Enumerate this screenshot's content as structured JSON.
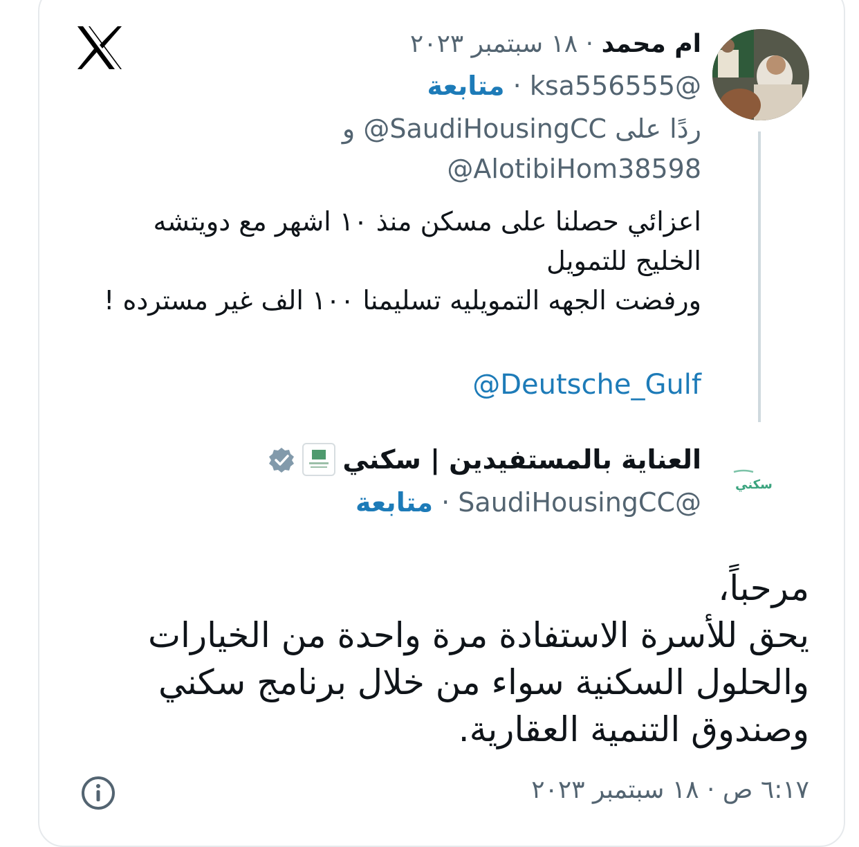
{
  "tweet1": {
    "display_name": "ام محمد",
    "date": "١٨ سبتمبر ٢٠٢٣",
    "handle": "@ksa556555",
    "follow_label": "متابعة",
    "reply_prefix": "ردًا على",
    "reply_to_1": "@SaudiHousingCC",
    "reply_and": "و",
    "reply_to_2": "@AlotibiHom38598",
    "body_line1": "اعزائي حصلنا على مسكن منذ ١٠ اشهر مع دويتشه",
    "body_line2": "الخليج للتمويل",
    "body_line3": "ورفضت الجهه التمويليه تسليمنا  ١٠٠ الف غير مسترده !",
    "mention": "@Deutsche_Gulf"
  },
  "tweet2": {
    "logo_text": "سكني",
    "display_name": "العناية بالمستفيدين | سكني",
    "handle": "@SaudiHousingCC",
    "follow_label": "متابعة",
    "body_line1": "مرحباً،",
    "body_line2": "يحق للأسرة الاستفادة مرة واحدة من الخيارات",
    "body_line3": "والحلول السكنية سواء من خلال برنامج سكني",
    "body_line4": "وصندوق التنمية العقارية.",
    "time": "٦:١٧ ص",
    "date": "١٨ سبتمبر ٢٠٢٣"
  },
  "icons": {
    "x_logo": "x-logo-icon",
    "verified": "verified-badge-icon",
    "info": "info-icon"
  },
  "colors": {
    "link": "#1d7bb8",
    "secondary_text": "#536471",
    "verified_badge": "#829aab"
  }
}
